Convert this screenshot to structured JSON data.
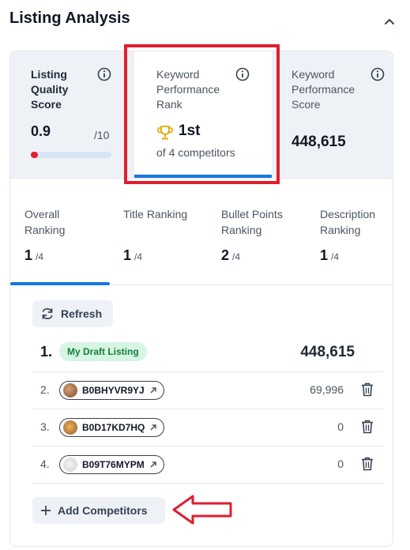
{
  "header": {
    "title": "Listing Analysis",
    "collapse_icon": "chevron-up-icon"
  },
  "metrics": {
    "listing_quality": {
      "label": "Listing Quality Score",
      "value": "0.9",
      "max": "/10",
      "progress_fraction": 0.09,
      "bar_color": "#e11d2e"
    },
    "keyword_rank": {
      "label": "Keyword Performance Rank",
      "rank": "1st",
      "sub": "of 4 competitors",
      "icon": "trophy-icon"
    },
    "keyword_score": {
      "label": "Keyword Performance Score",
      "value": "448,615"
    }
  },
  "rankings": [
    {
      "label": "Overall Ranking",
      "value": "1",
      "of": "/4"
    },
    {
      "label": "Title Ranking",
      "value": "1",
      "of": "/4"
    },
    {
      "label": "Bullet Points Ranking",
      "value": "2",
      "of": "/4"
    },
    {
      "label": "Description Ranking",
      "value": "1",
      "of": "/4"
    }
  ],
  "actions": {
    "refresh_label": "Refresh",
    "add_label": "Add Competitors"
  },
  "listings": {
    "draft": {
      "num": "1.",
      "badge": "My Draft Listing",
      "score": "448,615"
    },
    "competitors": [
      {
        "num": "2.",
        "asin": "B0BHYVR9YJ",
        "score": "69,996"
      },
      {
        "num": "3.",
        "asin": "B0D17KD7HQ",
        "score": "0"
      },
      {
        "num": "4.",
        "asin": "B09T76MYPM",
        "score": "0"
      }
    ]
  },
  "colors": {
    "accent": "#1677e0",
    "highlight": "#e11d2e",
    "badge_bg": "#d6f5e3",
    "badge_text": "#15803d"
  }
}
